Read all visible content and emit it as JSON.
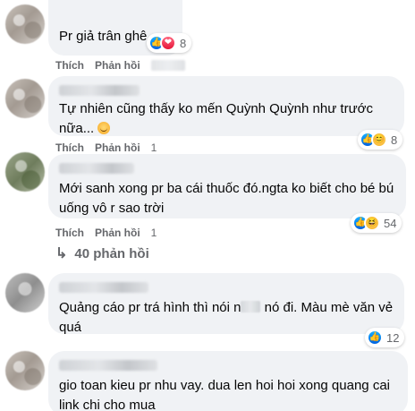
{
  "comments": [
    {
      "text": "Pr giả trân ghê",
      "actions": {
        "like": "Thích",
        "reply": "Phản hồi"
      },
      "reactions": {
        "icons": [
          "like-icon",
          "heart-icon"
        ],
        "count": "8"
      }
    },
    {
      "text": "Tự nhiên cũng thấy ko mến Quỳnh Quỳnh như trước nữa...",
      "emoji": "sweat-smile-emoji",
      "actions": {
        "like": "Thích",
        "reply": "Phản hồi",
        "time": "1"
      },
      "reactions": {
        "icons": [
          "like-icon",
          "care-icon"
        ],
        "count": "8"
      }
    },
    {
      "text": "Mới sanh xong pr ba cái thuốc đó.ngta ko biết cho bé bú uống vô r sao trời",
      "actions": {
        "like": "Thích",
        "reply": "Phản hồi",
        "time": "1"
      },
      "reactions": {
        "icons": [
          "like-icon",
          "haha-icon"
        ],
        "count": "54"
      },
      "replies_link": "40 phản hồi"
    },
    {
      "text_before": "Quảng cáo pr trá hình thì nói n",
      "text_after": " nó đi. Màu mè văn vẻ quá",
      "reactions": {
        "icons": [
          "like-icon"
        ],
        "count": "12"
      }
    },
    {
      "text": "gio toan kieu pr nhu vay. dua len hoi hoi xong quang cai link chi cho mua"
    }
  ],
  "colors": {
    "bubble": "#f0f2f5",
    "text": "#050505",
    "secondary": "#65676b",
    "like": "#0866ff"
  }
}
